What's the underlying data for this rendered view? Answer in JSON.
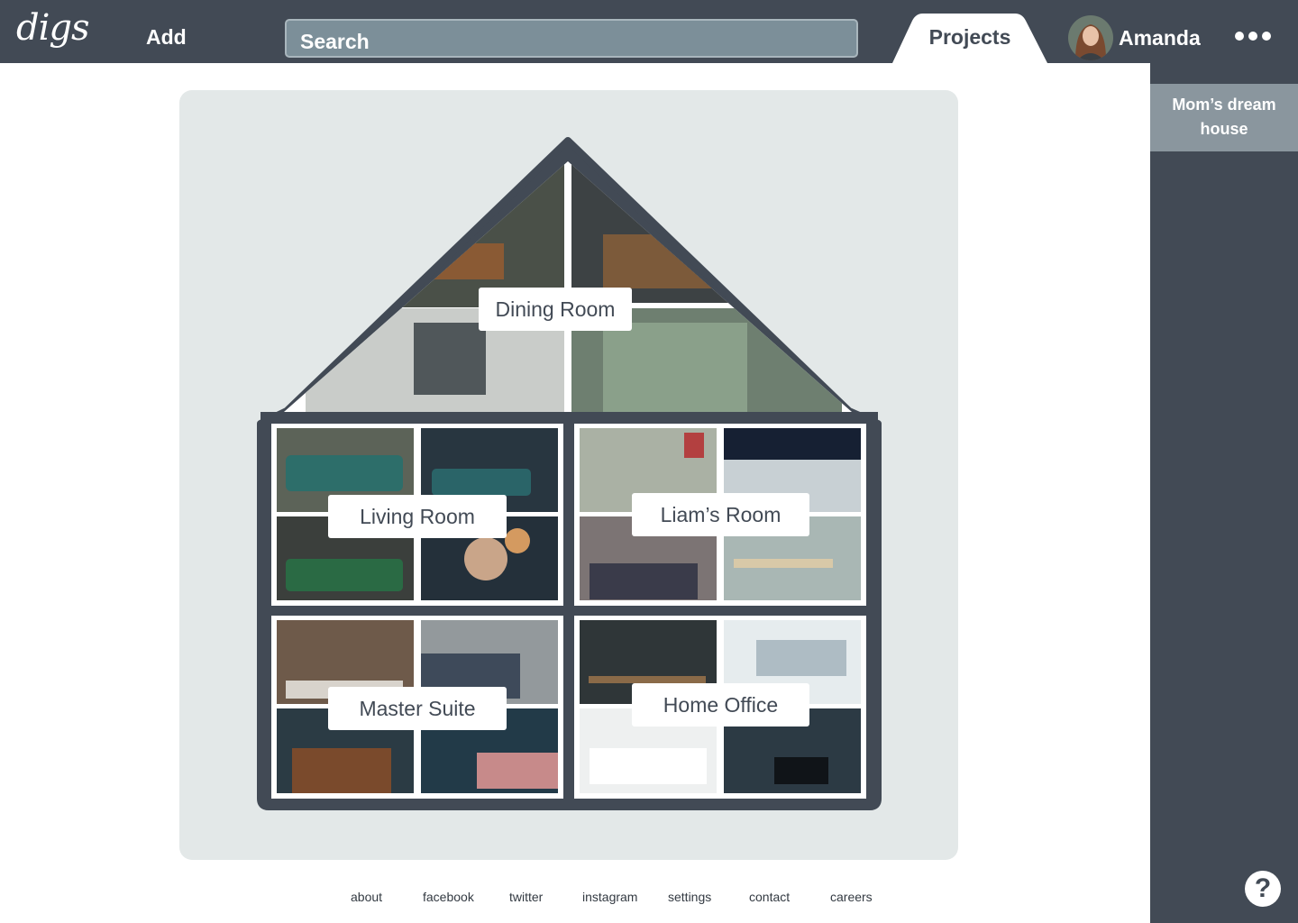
{
  "header": {
    "logo": "digs",
    "add_label": "Add",
    "search_placeholder": "Search",
    "projects_tab": "Projects",
    "user_name": "Amanda",
    "avatar_icon": "user-avatar",
    "more_icon": "more-dots-icon"
  },
  "sidebar": {
    "projects": [
      {
        "label": "Mom’s dream house"
      }
    ],
    "help_label": "?"
  },
  "house": {
    "rooms": [
      {
        "label": "Dining Room"
      },
      {
        "label": "Living Room"
      },
      {
        "label": "Liam’s Room"
      },
      {
        "label": "Master Suite"
      },
      {
        "label": "Home Office"
      }
    ]
  },
  "footer": {
    "links": [
      "about",
      "facebook",
      "twitter",
      "instagram",
      "settings",
      "contact",
      "careers"
    ]
  },
  "colors": {
    "header_bg": "#424a55",
    "panel_bg": "#e3e8e8",
    "active_project_bg": "#8a969e",
    "search_bg": "#7c8f99"
  }
}
